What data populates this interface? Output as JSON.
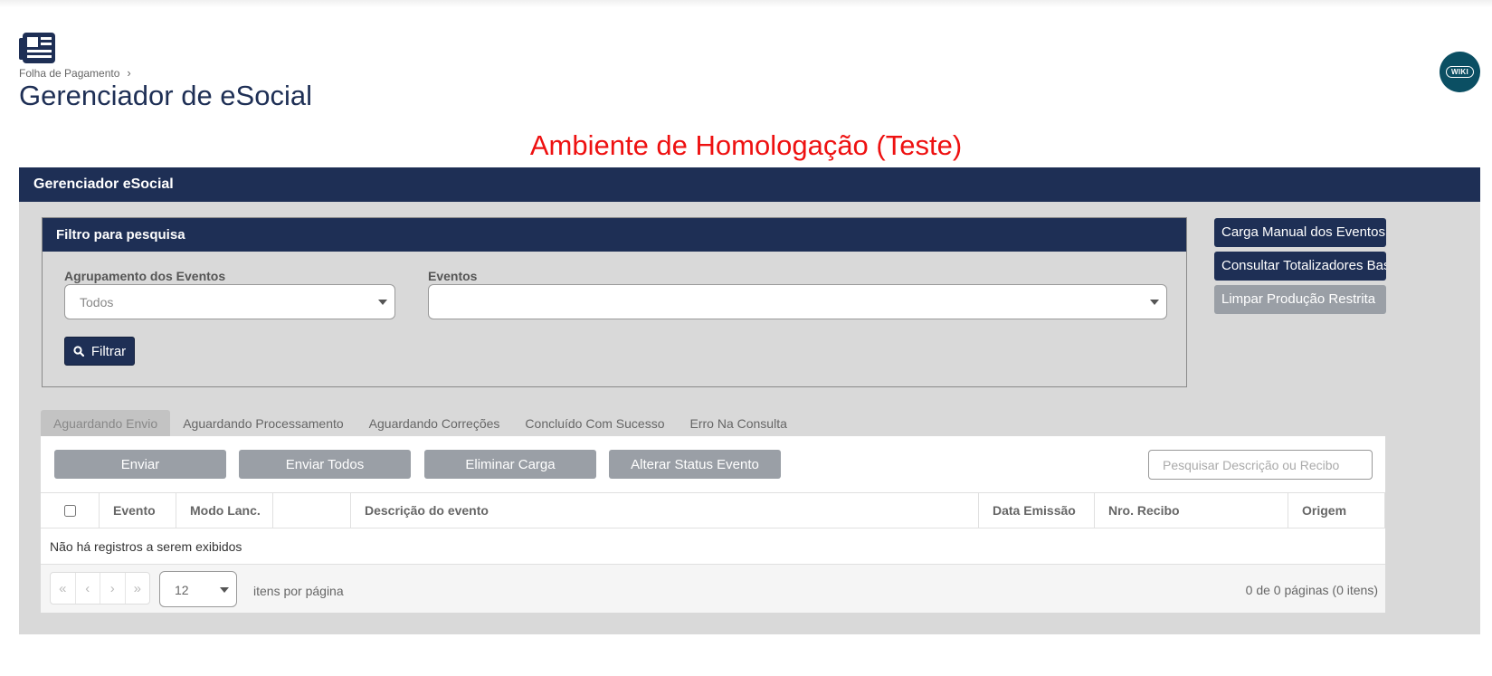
{
  "header": {
    "breadcrumb": "Folha de Pagamento",
    "title": "Gerenciador de eSocial",
    "wiki_label": "WIKI",
    "page_icon": "newspaper-icon"
  },
  "environment_banner": "Ambiente de Homologação (Teste)",
  "panel": {
    "title": "Gerenciador eSocial"
  },
  "filter": {
    "title": "Filtro para pesquisa",
    "group_label": "Agrupamento dos Eventos",
    "group_value": "Todos",
    "events_label": "Eventos",
    "events_value": "",
    "filter_button": "Filtrar"
  },
  "side_actions": [
    "Carga Manual dos Eventos",
    "Consultar Totalizadores Base",
    "Limpar Produção Restrita"
  ],
  "tabs": [
    "Aguardando Envio",
    "Aguardando Processamento",
    "Aguardando Correções",
    "Concluído Com Sucesso",
    "Erro Na Consulta"
  ],
  "active_tab": "Aguardando Envio",
  "actions": [
    "Enviar",
    "Enviar Todos",
    "Eliminar Carga",
    "Alterar Status Evento"
  ],
  "search": {
    "placeholder": "Pesquisar Descrição ou Recibo",
    "value": ""
  },
  "grid": {
    "columns": [
      "Evento",
      "Modo Lanc.",
      "",
      "Descrição do evento",
      "Data Emissão",
      "Nro. Recibo",
      "Origem"
    ],
    "empty_message": "Não há registros a serem exibidos"
  },
  "pager": {
    "page_size": "12",
    "per_page_label": "itens por página",
    "info": "0 de 0 páginas (0 itens)"
  },
  "colors": {
    "navy": "#1e2f55",
    "banner_red": "#ee1111",
    "disabled_gray": "#9a9fa6",
    "wiki_teal": "#0b4f63"
  }
}
